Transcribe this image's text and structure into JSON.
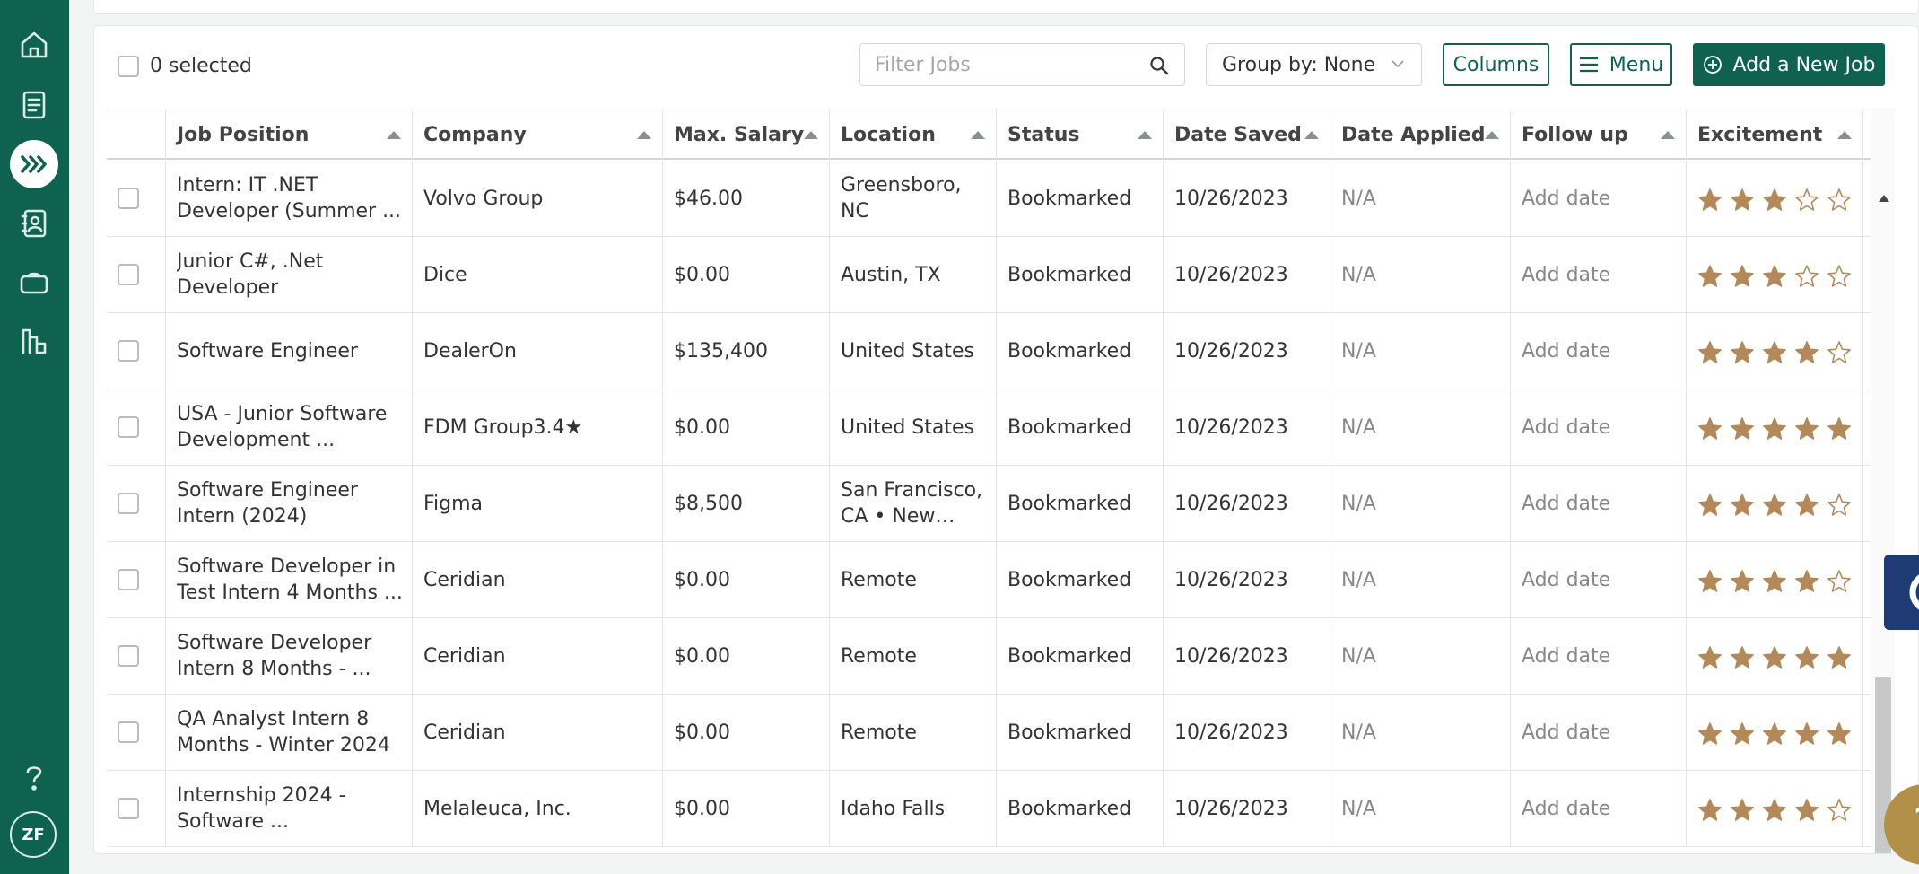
{
  "sidebar": {
    "icons": [
      "home-icon",
      "document-icon",
      "jobs-chevrons-icon",
      "contacts-icon",
      "briefcase-icon",
      "chart-icon",
      "help-icon"
    ],
    "avatar_initials": "ZF"
  },
  "toolbar": {
    "selected_label": "0 selected",
    "filter_placeholder": "Filter Jobs",
    "groupby_label": "Group by: None",
    "columns_label": "Columns",
    "menu_label": "Menu",
    "add_label": "Add a New Job"
  },
  "columns": [
    "Job Position",
    "Company",
    "Max. Salary",
    "Location",
    "Status",
    "Date Saved",
    "Date Applied",
    "Follow up",
    "Excitement"
  ],
  "rows": [
    {
      "position": "Intern: IT .NET Developer (Summer ...",
      "company": "Volvo Group",
      "salary": "$46.00",
      "location": "Greensboro, NC",
      "status": "Bookmarked",
      "date_saved": "10/26/2023",
      "date_applied": "N/A",
      "follow_up": "Add date",
      "excitement": 3
    },
    {
      "position": "Junior C#, .Net Developer",
      "company": "Dice",
      "salary": "$0.00",
      "location": "Austin, TX",
      "status": "Bookmarked",
      "date_saved": "10/26/2023",
      "date_applied": "N/A",
      "follow_up": "Add date",
      "excitement": 3
    },
    {
      "position": "Software Engineer",
      "company": "DealerOn",
      "salary": "$135,400",
      "location": "United States",
      "status": "Bookmarked",
      "date_saved": "10/26/2023",
      "date_applied": "N/A",
      "follow_up": "Add date",
      "excitement": 4
    },
    {
      "position": "USA - Junior Software Development ...",
      "company": "FDM Group3.4★",
      "salary": "$0.00",
      "location": "United States",
      "status": "Bookmarked",
      "date_saved": "10/26/2023",
      "date_applied": "N/A",
      "follow_up": "Add date",
      "excitement": 5
    },
    {
      "position": "Software Engineer Intern (2024)",
      "company": "Figma",
      "salary": "$8,500",
      "location": "San Francisco, CA • New York...",
      "status": "Bookmarked",
      "date_saved": "10/26/2023",
      "date_applied": "N/A",
      "follow_up": "Add date",
      "excitement": 4
    },
    {
      "position": "Software Developer in Test Intern 4 Months ...",
      "company": "Ceridian",
      "salary": "$0.00",
      "location": "Remote",
      "status": "Bookmarked",
      "date_saved": "10/26/2023",
      "date_applied": "N/A",
      "follow_up": "Add date",
      "excitement": 4
    },
    {
      "position": "Software Developer Intern 8 Months - ...",
      "company": "Ceridian",
      "salary": "$0.00",
      "location": "Remote",
      "status": "Bookmarked",
      "date_saved": "10/26/2023",
      "date_applied": "N/A",
      "follow_up": "Add date",
      "excitement": 5
    },
    {
      "position": "QA Analyst Intern 8 Months - Winter 2024",
      "company": "Ceridian",
      "salary": "$0.00",
      "location": "Remote",
      "status": "Bookmarked",
      "date_saved": "10/26/2023",
      "date_applied": "N/A",
      "follow_up": "Add date",
      "excitement": 5
    },
    {
      "position": "Internship 2024 - Software ...",
      "company": "Melaleuca, Inc.",
      "salary": "$0.00",
      "location": "Idaho Falls",
      "status": "Bookmarked",
      "date_saved": "10/26/2023",
      "date_applied": "N/A",
      "follow_up": "Add date",
      "excitement": 4
    }
  ],
  "widgets": {
    "help_fab_label": "?"
  },
  "colors": {
    "brand_green": "#0f6150",
    "star_gold": "#b3895a",
    "widget_navy": "#1f3b73",
    "fab_gold": "#b3904a"
  }
}
